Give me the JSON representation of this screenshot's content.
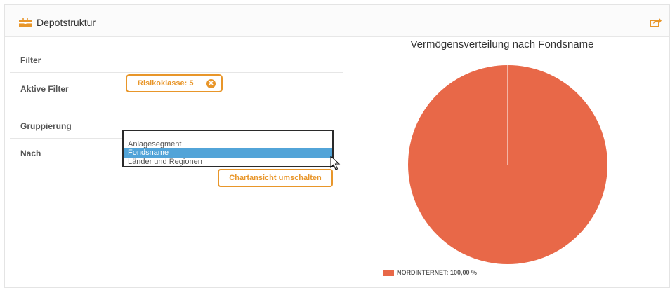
{
  "header": {
    "title": "Depotstruktur",
    "icon": "briefcase-icon",
    "export_icon": "export-icon"
  },
  "filter": {
    "section_label": "Filter",
    "active_label": "Aktive Filter",
    "chip_label": "Risikoklasse: 5"
  },
  "grouping": {
    "section_label": "Gruppierung",
    "by_label": "Nach",
    "options": [
      {
        "label": "Anlagesegment",
        "selected": false
      },
      {
        "label": "Fondsname",
        "selected": true
      },
      {
        "label": "Länder und Regionen",
        "selected": false
      }
    ],
    "toggle_button": "Chartansicht umschalten"
  },
  "colors": {
    "accent": "#e8962a",
    "selection": "#52a4d8",
    "pie": "#e86848"
  },
  "chart_data": {
    "type": "pie",
    "title": "Vermögensverteilung nach Fondsname",
    "slices": [
      {
        "name": "NORDINTERNET",
        "value": 100.0,
        "color": "#e86848"
      }
    ],
    "legend": [
      {
        "label": "NORDINTERNET: 100,00 %",
        "color": "#e86848"
      }
    ],
    "legend_position": "bottom-left"
  }
}
